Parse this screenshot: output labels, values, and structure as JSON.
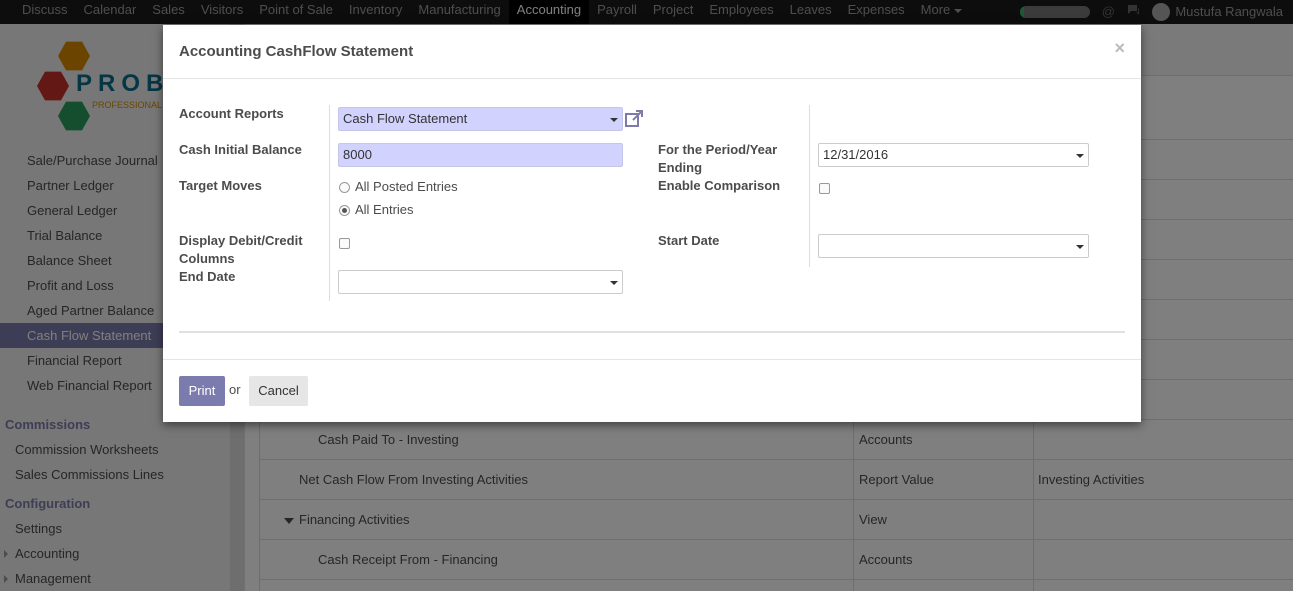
{
  "topbar": {
    "menu": [
      "Discuss",
      "Calendar",
      "Sales",
      "Visitors",
      "Point of Sale",
      "Inventory",
      "Manufacturing",
      "Accounting",
      "Payroll",
      "Project",
      "Employees",
      "Leaves",
      "Expenses",
      "More"
    ],
    "active_index": 7,
    "progress_fraction": 0.05,
    "user_name": "Mustufa Rangwala",
    "colors": {
      "bar": "#1a1a1a",
      "progress": "#39b36a"
    }
  },
  "sidebar": {
    "logo_text": "PROBI",
    "logo_tagline": "PROFESSIONAL B",
    "reports": [
      "Sale/Purchase Journal",
      "Partner Ledger",
      "General Ledger",
      "Trial Balance",
      "Balance Sheet",
      "Profit and Loss",
      "Aged Partner Balance",
      "Cash Flow Statement",
      "Financial Report",
      "Web Financial Report"
    ],
    "active_report_index": 7,
    "commissions_header": "Commissions",
    "commissions": [
      "Commission Worksheets",
      "Sales Commissions Lines"
    ],
    "configuration_header": "Configuration",
    "config_settings": "Settings",
    "config_accounting": "Accounting",
    "config_management": "Management"
  },
  "grid": {
    "rows": [
      {
        "name": "Cash Paid To - Investing",
        "type": "Accounts",
        "parent": ""
      },
      {
        "name": "Net Cash Flow From Investing Activities",
        "type": "Report Value",
        "parent": "Investing Activities"
      },
      {
        "name": "Financing Activities",
        "type": "View",
        "parent": ""
      },
      {
        "name": "Cash Receipt From - Financing",
        "type": "Accounts",
        "parent": ""
      }
    ]
  },
  "modal": {
    "title": "Accounting CashFlow Statement",
    "close": "×",
    "account_reports_label": "Account Reports",
    "account_reports_value": "Cash Flow Statement",
    "cash_initial_label": "Cash Initial Balance",
    "cash_initial_value": "8000",
    "period_label_1": "For the Period/Year",
    "period_label_2": "Ending",
    "period_value": "12/31/2016",
    "target_moves_label": "Target Moves",
    "target_option_1": "All Posted Entries",
    "target_option_2": "All Entries",
    "enable_comparison_label": "Enable Comparison",
    "display_debit_label_1": "Display Debit/Credit",
    "display_debit_label_2": "Columns",
    "start_date_label": "Start Date",
    "end_date_label": "End Date",
    "print": "Print",
    "or": "or",
    "cancel": "Cancel",
    "accent": "#7c7bad"
  }
}
